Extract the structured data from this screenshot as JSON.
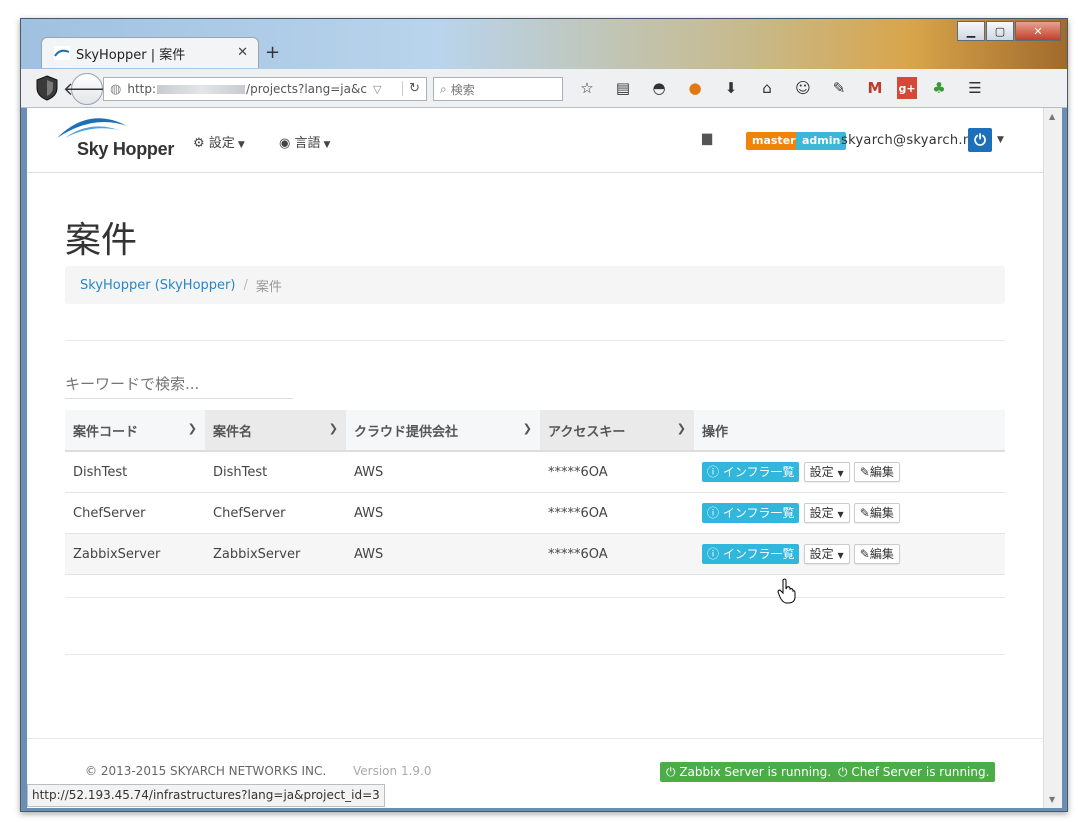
{
  "browser": {
    "tab_title": "SkyHopper | 案件",
    "tab_close": "✕",
    "new_tab": "+",
    "url_prefix": "http:",
    "url_suffix": "/projects?lang=ja&c",
    "search_placeholder": "検索",
    "status_url": "http://52.193.45.74/infrastructures?lang=ja&project_id=3"
  },
  "header": {
    "logo_text": "Sky Hopper",
    "menu_settings": "設定",
    "menu_language": "言語",
    "badge_master": "master",
    "badge_admin": "admin",
    "user_email": "skyarch@skyarch.net"
  },
  "page": {
    "title": "案件",
    "breadcrumb_link": "SkyHopper (SkyHopper)",
    "breadcrumb_sep": "/",
    "breadcrumb_current": "案件",
    "search_placeholder": "キーワードで検索..."
  },
  "table": {
    "headers": [
      "案件コード",
      "案件名",
      "クラウド提供会社",
      "アクセスキー",
      "操作"
    ],
    "rows": [
      {
        "code": "DishTest",
        "name": "DishTest",
        "cloud": "AWS",
        "key": "*****6OA"
      },
      {
        "code": "ChefServer",
        "name": "ChefServer",
        "cloud": "AWS",
        "key": "*****6OA"
      },
      {
        "code": "ZabbixServer",
        "name": "ZabbixServer",
        "cloud": "AWS",
        "key": "*****6OA"
      }
    ],
    "btn_infra": "インフラ一覧",
    "btn_settings": "設定",
    "btn_edit": "編集"
  },
  "footer": {
    "copyright": "© 2013-2015 SKYARCH NETWORKS INC.",
    "version": "Version 1.9.0",
    "zabbix_status": "Zabbix Server is running.",
    "chef_status": "Chef Server is running."
  },
  "colors": {
    "brand_blue": "#1c70b9",
    "link_blue": "#2a86c9",
    "badge_master": "#f0830a",
    "badge_admin": "#3bb7d8",
    "info_button": "#32b7dc",
    "status_green": "#4aad48"
  }
}
